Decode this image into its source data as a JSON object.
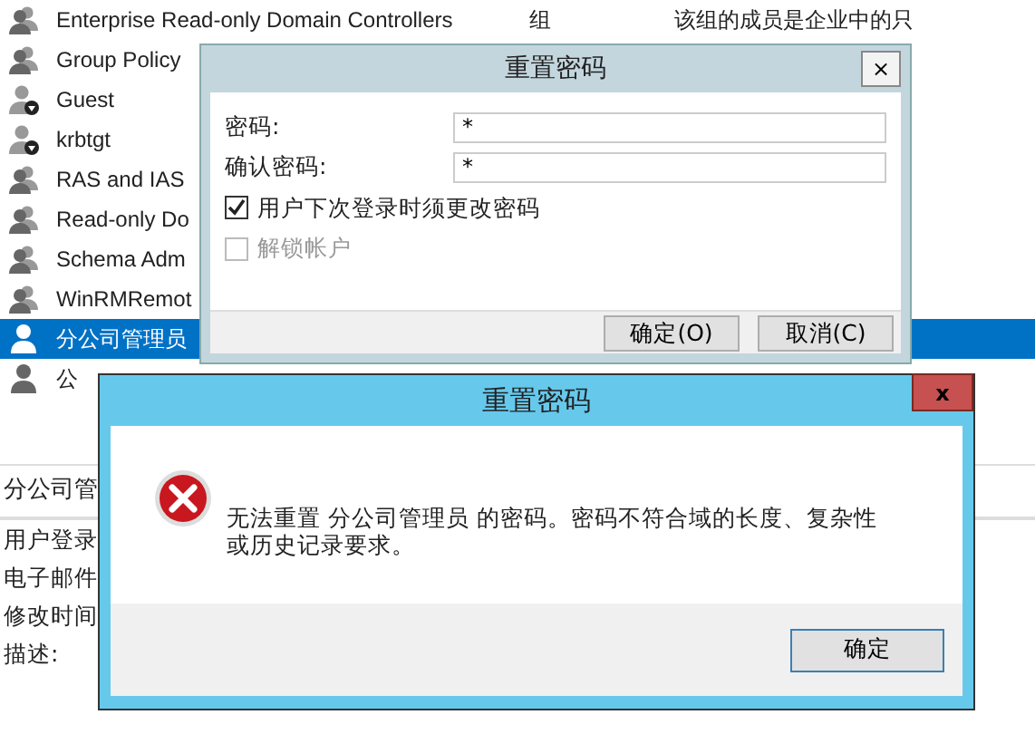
{
  "list_rows": [
    {
      "name": "Enterprise Read-only Domain Controllers",
      "type": "组",
      "description": "该组的成员是企业中的只",
      "kind": "group",
      "selected": false
    },
    {
      "name": "Group Policy",
      "kind": "group",
      "selected": false
    },
    {
      "name": "Guest",
      "kind": "user-disabled",
      "selected": false
    },
    {
      "name": "krbtgt",
      "kind": "user-disabled",
      "selected": false
    },
    {
      "name": "RAS and IAS",
      "kind": "group",
      "selected": false
    },
    {
      "name": "Read-only Do",
      "kind": "group",
      "selected": false
    },
    {
      "name": "Schema Adm",
      "kind": "group",
      "selected": false
    },
    {
      "name": "WinRMRemot",
      "kind": "group",
      "selected": false
    },
    {
      "name": "分公司管理员",
      "kind": "user",
      "selected": true
    },
    {
      "name": "公",
      "kind": "user",
      "selected": false
    }
  ],
  "details_panel": {
    "title": "分公司管",
    "fields": [
      "用户登录",
      "电子邮件",
      "修改时间",
      "描述:"
    ]
  },
  "reset_dialog": {
    "title": "重置密码",
    "close": "×",
    "fields": [
      {
        "label": "密码:",
        "value": "*"
      },
      {
        "label": "确认密码:",
        "value": "*"
      }
    ],
    "checkboxes": [
      {
        "label": "用户下次登录时须更改密码",
        "checked": true,
        "disabled": false
      },
      {
        "label": "解锁帐户",
        "checked": false,
        "disabled": true
      }
    ],
    "buttons": [
      "确定(O)",
      "取消(C)"
    ]
  },
  "error_dialog": {
    "title": "重置密码",
    "close": "x",
    "message": "无法重置 分公司管理员 的密码。密码不符合域的长度、复杂性或历史记录要求。",
    "button": "确定"
  }
}
